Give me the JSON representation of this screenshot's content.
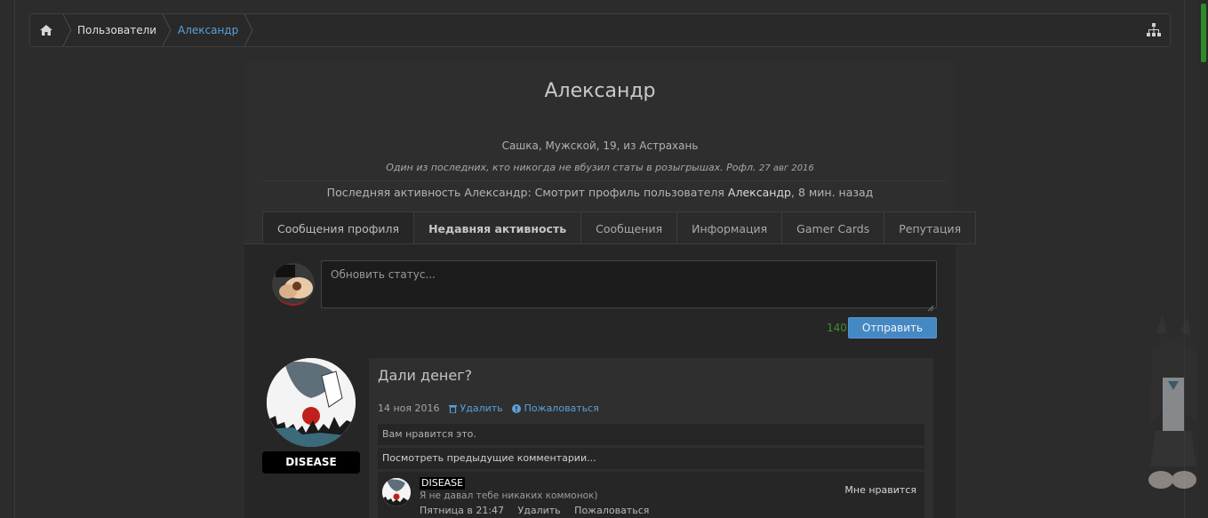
{
  "breadcrumb": {
    "home_icon": "home-icon",
    "items": [
      "Пользователи",
      "Александр"
    ],
    "sitemap_icon": "sitemap-icon"
  },
  "profile": {
    "name": "Александр",
    "info": "Сашка, Мужской, 19, из Астрахань",
    "custom_title": "Один из последних, кто никогда не вбузил статы в розыгрышах. Рофл.",
    "custom_date": "27 авг 2016",
    "activity_prefix": "Последняя активность Александр:",
    "activity_text": "Смотрит профиль пользователя",
    "activity_user": "Александр",
    "activity_time": ", 8 мин. назад"
  },
  "tabs": [
    {
      "label": "Сообщения профиля",
      "active": true
    },
    {
      "label": "Недавняя активность",
      "active": false
    },
    {
      "label": "Сообщения",
      "active": false
    },
    {
      "label": "Информация",
      "active": false
    },
    {
      "label": "Gamer Cards",
      "active": false
    },
    {
      "label": "Репутация",
      "active": false
    }
  ],
  "status": {
    "placeholder": "Обновить статус...",
    "counter": "140",
    "submit_label": "Отправить"
  },
  "message": {
    "author": "DISEASE",
    "text": "Дали денег?",
    "date": "14 ноя 2016",
    "delete_label": "Удалить",
    "report_label": "Пожаловаться",
    "likes_text": "Вам нравится это.",
    "prev_comments": "Посмотреть предыдущие комментарии...",
    "comment": {
      "author": "DISEASE",
      "text": "Я не давал тебе никаких коммонок)",
      "time": "Пятница в 21:47",
      "delete_label": "Удалить",
      "report_label": "Пожаловаться",
      "like_label": "Мне нравится"
    }
  },
  "colors": {
    "link": "#5aa0d8",
    "button": "#4589c4",
    "counter": "#3f8f2e",
    "scroll_thumb": "#2f8a2a"
  }
}
